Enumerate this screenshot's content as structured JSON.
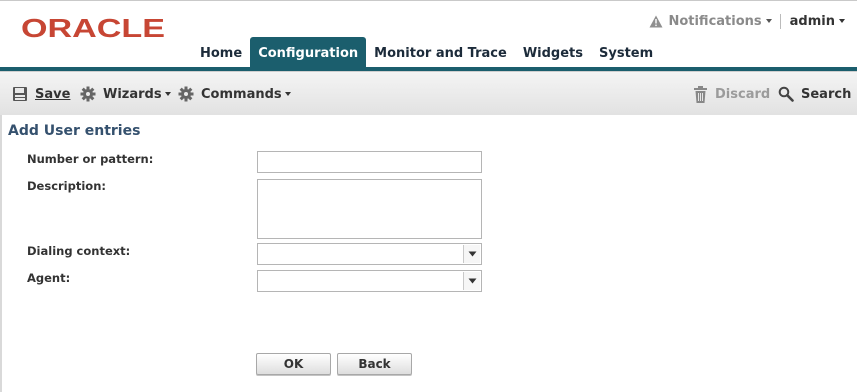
{
  "header": {
    "brand": "ORACLE",
    "notifications_label": "Notifications",
    "user_label": "admin",
    "tabs": [
      {
        "label": "Home",
        "active": false
      },
      {
        "label": "Configuration",
        "active": true
      },
      {
        "label": "Monitor and Trace",
        "active": false
      },
      {
        "label": "Widgets",
        "active": false
      },
      {
        "label": "System",
        "active": false
      }
    ]
  },
  "toolbar": {
    "save_label": "Save",
    "wizards_label": "Wizards",
    "commands_label": "Commands",
    "discard_label": "Discard",
    "search_label": "Search"
  },
  "form": {
    "title": "Add User entries",
    "number_label": "Number or pattern:",
    "number_value": "",
    "description_label": "Description:",
    "description_value": "",
    "dialing_context_label": "Dialing context:",
    "dialing_context_value": "",
    "agent_label": "Agent:",
    "agent_value": "",
    "ok_label": "OK",
    "back_label": "Back"
  },
  "colors": {
    "brand_red": "#c74634",
    "accent_teal": "#1b5e6d",
    "title_blue": "#35516e"
  },
  "icons": [
    "warning-icon",
    "save-icon",
    "gear-icon",
    "trash-icon",
    "search-icon",
    "chevron-down-icon"
  ]
}
